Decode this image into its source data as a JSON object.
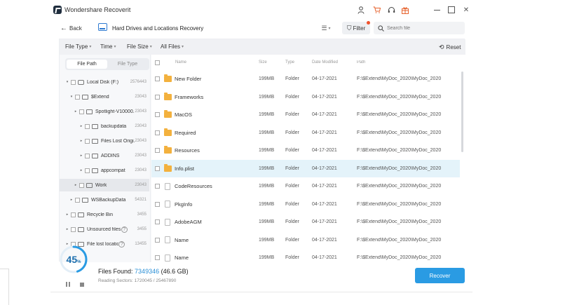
{
  "app": {
    "title": "Wondershare Recoverit"
  },
  "titlebar": {
    "icons": [
      "user-icon",
      "cart-icon",
      "support-icon",
      "gift-icon",
      "minimize-icon",
      "maximize-icon",
      "close-icon"
    ],
    "close_glyph": "✕"
  },
  "nav": {
    "back_label": "Back",
    "title": "Hard Drives and Locations Recovery",
    "filter_label": "Filter",
    "search_placeholder": "Search file"
  },
  "filters": {
    "file_type": "File Type",
    "time": "Time",
    "file_size": "File Size",
    "all_files": "All Files",
    "reset": "Reset"
  },
  "tree": {
    "tabs": [
      "File Path",
      "File Type"
    ],
    "active_tab": "File Path",
    "items": [
      {
        "label": "Local Disk (F:)",
        "count": "2576443"
      },
      {
        "label": "$Extend",
        "count": "23043"
      },
      {
        "label": "Spotlight-V10000...",
        "count": "23043"
      },
      {
        "label": "backupdata",
        "count": "23043"
      },
      {
        "label": "Files Lost Origi...",
        "count": "23043"
      },
      {
        "label": "ADDINS",
        "count": "23043"
      },
      {
        "label": "appcompat",
        "count": "23043"
      },
      {
        "label": "Work",
        "count": "23043"
      },
      {
        "label": "WSBackupData",
        "count": "54321"
      },
      {
        "label": "Recycle Bin",
        "count": "3455"
      },
      {
        "label": "Unsourced files",
        "count": "3455"
      },
      {
        "label": "File lost location",
        "count": "13455"
      }
    ]
  },
  "table": {
    "headers": {
      "name": "Name",
      "size": "Size",
      "type": "Type",
      "date": "Date Modified",
      "path": "Path"
    },
    "rows": [
      {
        "name": "New Folder",
        "size": "199MB",
        "type": "Folder",
        "date": "04-17-2021",
        "path": "F:\\$Extend\\MyDoc_2020\\MyDoc_2020\\M..."
      },
      {
        "name": "Frameworks",
        "size": "199MB",
        "type": "Folder",
        "date": "04-17-2021",
        "path": "F:\\$Extend\\MyDoc_2020\\MyDoc_2020\\M..."
      },
      {
        "name": "MacOS",
        "size": "199MB",
        "type": "Folder",
        "date": "04-17-2021",
        "path": "F:\\$Extend\\MyDoc_2020\\MyDoc_2020\\M..."
      },
      {
        "name": "Required",
        "size": "199MB",
        "type": "Folder",
        "date": "04-17-2021",
        "path": "F:\\$Extend\\MyDoc_2020\\MyDoc_2020\\M..."
      },
      {
        "name": "Resources",
        "size": "199MB",
        "type": "Folder",
        "date": "04-17-2021",
        "path": "F:\\$Extend\\MyDoc_2020\\MyDoc_2020\\M..."
      },
      {
        "name": "Info.plist",
        "size": "199MB",
        "type": "Folder",
        "date": "04-17-2021",
        "path": "F:\\$Extend\\MyDoc_2020\\MyDoc_2020\\M..."
      },
      {
        "name": "CodeResources",
        "size": "199MB",
        "type": "Folder",
        "date": "04-17-2021",
        "path": "F:\\$Extend\\MyDoc_2020\\MyDoc_2020\\M..."
      },
      {
        "name": "PkgInfo",
        "size": "199MB",
        "type": "Folder",
        "date": "04-17-2021",
        "path": "F:\\$Extend\\MyDoc_2020\\MyDoc_2020\\M..."
      },
      {
        "name": "AdobeAGM",
        "size": "199MB",
        "type": "Folder",
        "date": "04-17-2021",
        "path": "F:\\$Extend\\MyDoc_2020\\MyDoc_2020\\M..."
      },
      {
        "name": "Name",
        "size": "199MB",
        "type": "Folder",
        "date": "04-17-2021",
        "path": "F:\\$Extend\\MyDoc_2020\\MyDoc_2020\\M..."
      },
      {
        "name": "Name",
        "size": "199MB",
        "type": "Folder",
        "date": "04-17-2021",
        "path": "F:\\$Extend\\MyDoc_2020\\MyDoc_2020\\M..."
      }
    ]
  },
  "status": {
    "progress_percent": "45",
    "progress_sign": "%",
    "files_found_label": "Files Found:",
    "files_found_count": "7349346",
    "files_found_size": "(46.6 GB)",
    "reading_sectors": "Reading Sectors: 1720045 / 25467890",
    "recover_label": "Recover"
  },
  "colors": {
    "accent": "#2a9be3",
    "progress": "#1d6fae",
    "folder": "#f3b13e",
    "highlight_row": "#e4f3fa",
    "orange": "#e6622c"
  }
}
